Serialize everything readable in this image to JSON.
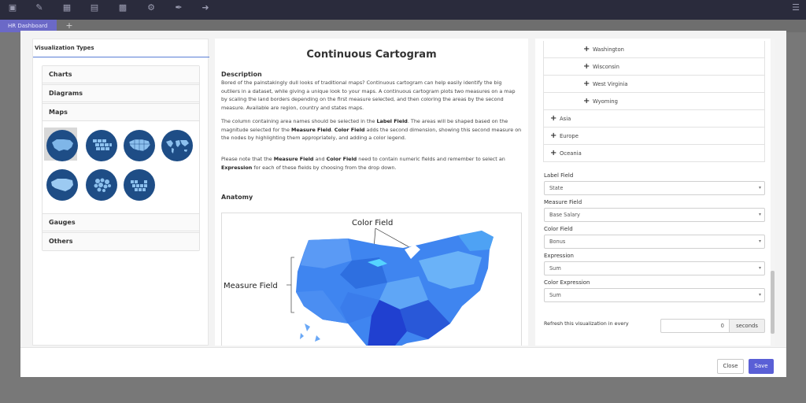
{
  "topbar": {
    "icons": [
      "save-icon",
      "edit-icon",
      "trash-icon",
      "bar-chart-icon",
      "grid-icon",
      "gear-icon",
      "brush-icon",
      "logout-icon",
      "menu-icon"
    ],
    "tab_label": "HR Dashboard",
    "add_tab": "+"
  },
  "left": {
    "title": "Visualization Types",
    "groups": [
      "Charts",
      "Diagrams",
      "Maps",
      "Gauges",
      "Others"
    ]
  },
  "center": {
    "title": "Continuous Cartogram",
    "description_heading": "Description",
    "p1": "Bored of the painstakingly dull looks of traditional maps? Continuous cartogram can help easily identify the big outliers in a dataset, while giving a unique look to your maps. A continuous cartogram plots two measures on a map by scaling the land borders depending on the first measure selected, and then coloring the areas by the second measure. Available are region, country and states maps.",
    "p2_a": "The column containing area names should be selected in the ",
    "p2_b1": "Label Field",
    "p2_c": ". The areas will be shaped based on the magnitude selected for the ",
    "p2_b2": "Measure Field",
    "p2_d": ". ",
    "p2_b3": "Color Field",
    "p2_e": " adds the second dimension, showing this second measure on the nodes by highlighting them appropriately, and adding a color legend.",
    "p3_a": "Please note that the ",
    "p3_b1": "Measure Field",
    "p3_c": " and ",
    "p3_b2": "Color Field",
    "p3_d": " need to contain numeric fields and remember to select an ",
    "p3_b3": "Expression",
    "p3_e": " for each of these fields by choosing from the drop down.",
    "anatomy_heading": "Anatomy",
    "anatomy_color_label": "Color Field",
    "anatomy_measure_label": "Measure Field"
  },
  "right": {
    "tree_items": [
      {
        "label": "Washington",
        "level": 2
      },
      {
        "label": "Wisconsin",
        "level": 2
      },
      {
        "label": "West Virginia",
        "level": 2
      },
      {
        "label": "Wyoming",
        "level": 2
      },
      {
        "label": "Asia",
        "level": 1
      },
      {
        "label": "Europe",
        "level": 1
      },
      {
        "label": "Oceania",
        "level": 1
      }
    ],
    "fields": [
      {
        "label": "Label Field",
        "value": "State"
      },
      {
        "label": "Measure Field",
        "value": "Base Salary"
      },
      {
        "label": "Color Field",
        "value": "Bonus"
      },
      {
        "label": "Expression",
        "value": "Sum"
      },
      {
        "label": "Color Expression",
        "value": "Sum"
      }
    ],
    "refresh_label": "Refresh this visualization in every",
    "refresh_value": "0",
    "refresh_unit": "seconds"
  },
  "footer": {
    "close_label": "Close",
    "save_label": "Save"
  },
  "colors": {
    "accent": "#5a5fd6",
    "topbar": "#2a2b3c",
    "map_circle": "#1e4d86"
  }
}
